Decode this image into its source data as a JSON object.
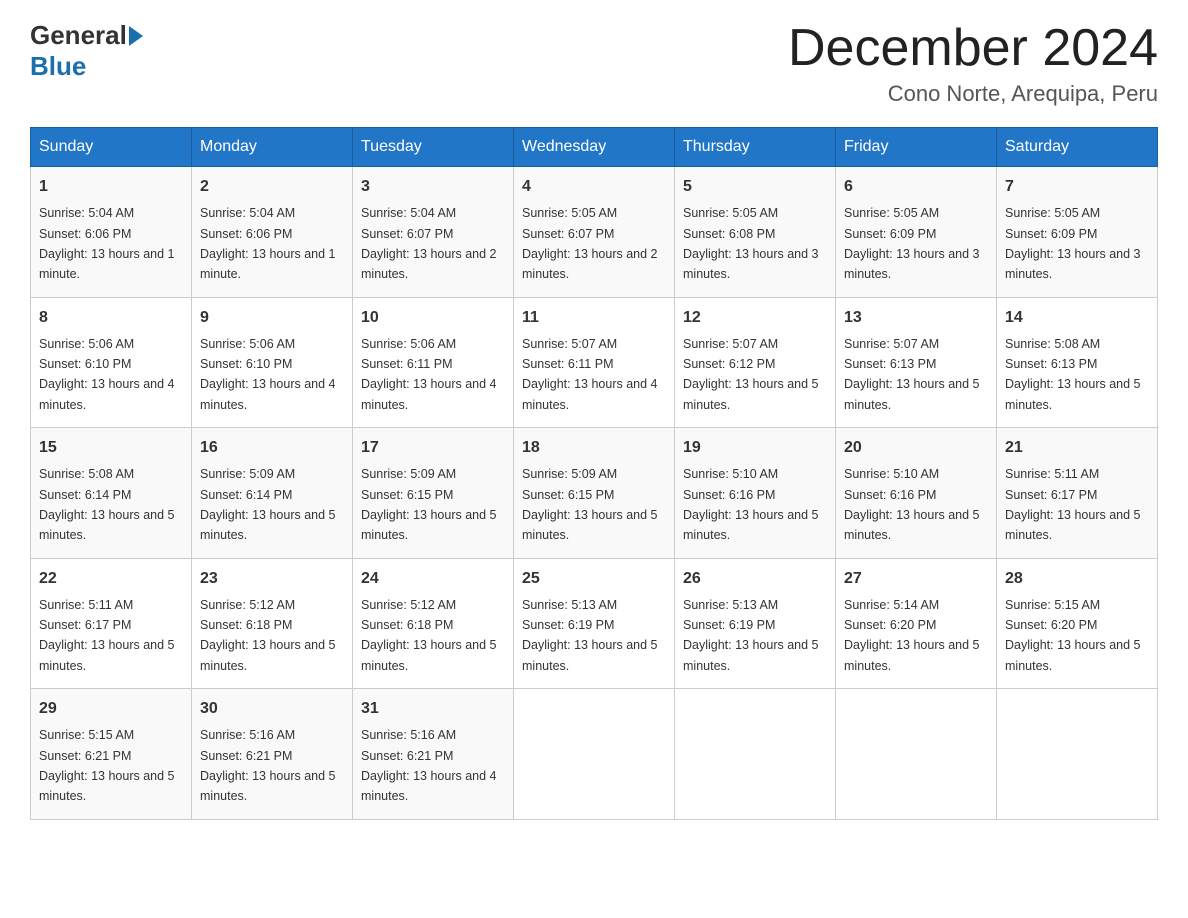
{
  "logo": {
    "general": "General",
    "blue": "Blue"
  },
  "title": {
    "month_year": "December 2024",
    "location": "Cono Norte, Arequipa, Peru"
  },
  "days_of_week": [
    "Sunday",
    "Monday",
    "Tuesday",
    "Wednesday",
    "Thursday",
    "Friday",
    "Saturday"
  ],
  "weeks": [
    [
      {
        "day": "1",
        "sunrise": "5:04 AM",
        "sunset": "6:06 PM",
        "daylight": "13 hours and 1 minute."
      },
      {
        "day": "2",
        "sunrise": "5:04 AM",
        "sunset": "6:06 PM",
        "daylight": "13 hours and 1 minute."
      },
      {
        "day": "3",
        "sunrise": "5:04 AM",
        "sunset": "6:07 PM",
        "daylight": "13 hours and 2 minutes."
      },
      {
        "day": "4",
        "sunrise": "5:05 AM",
        "sunset": "6:07 PM",
        "daylight": "13 hours and 2 minutes."
      },
      {
        "day": "5",
        "sunrise": "5:05 AM",
        "sunset": "6:08 PM",
        "daylight": "13 hours and 3 minutes."
      },
      {
        "day": "6",
        "sunrise": "5:05 AM",
        "sunset": "6:09 PM",
        "daylight": "13 hours and 3 minutes."
      },
      {
        "day": "7",
        "sunrise": "5:05 AM",
        "sunset": "6:09 PM",
        "daylight": "13 hours and 3 minutes."
      }
    ],
    [
      {
        "day": "8",
        "sunrise": "5:06 AM",
        "sunset": "6:10 PM",
        "daylight": "13 hours and 4 minutes."
      },
      {
        "day": "9",
        "sunrise": "5:06 AM",
        "sunset": "6:10 PM",
        "daylight": "13 hours and 4 minutes."
      },
      {
        "day": "10",
        "sunrise": "5:06 AM",
        "sunset": "6:11 PM",
        "daylight": "13 hours and 4 minutes."
      },
      {
        "day": "11",
        "sunrise": "5:07 AM",
        "sunset": "6:11 PM",
        "daylight": "13 hours and 4 minutes."
      },
      {
        "day": "12",
        "sunrise": "5:07 AM",
        "sunset": "6:12 PM",
        "daylight": "13 hours and 5 minutes."
      },
      {
        "day": "13",
        "sunrise": "5:07 AM",
        "sunset": "6:13 PM",
        "daylight": "13 hours and 5 minutes."
      },
      {
        "day": "14",
        "sunrise": "5:08 AM",
        "sunset": "6:13 PM",
        "daylight": "13 hours and 5 minutes."
      }
    ],
    [
      {
        "day": "15",
        "sunrise": "5:08 AM",
        "sunset": "6:14 PM",
        "daylight": "13 hours and 5 minutes."
      },
      {
        "day": "16",
        "sunrise": "5:09 AM",
        "sunset": "6:14 PM",
        "daylight": "13 hours and 5 minutes."
      },
      {
        "day": "17",
        "sunrise": "5:09 AM",
        "sunset": "6:15 PM",
        "daylight": "13 hours and 5 minutes."
      },
      {
        "day": "18",
        "sunrise": "5:09 AM",
        "sunset": "6:15 PM",
        "daylight": "13 hours and 5 minutes."
      },
      {
        "day": "19",
        "sunrise": "5:10 AM",
        "sunset": "6:16 PM",
        "daylight": "13 hours and 5 minutes."
      },
      {
        "day": "20",
        "sunrise": "5:10 AM",
        "sunset": "6:16 PM",
        "daylight": "13 hours and 5 minutes."
      },
      {
        "day": "21",
        "sunrise": "5:11 AM",
        "sunset": "6:17 PM",
        "daylight": "13 hours and 5 minutes."
      }
    ],
    [
      {
        "day": "22",
        "sunrise": "5:11 AM",
        "sunset": "6:17 PM",
        "daylight": "13 hours and 5 minutes."
      },
      {
        "day": "23",
        "sunrise": "5:12 AM",
        "sunset": "6:18 PM",
        "daylight": "13 hours and 5 minutes."
      },
      {
        "day": "24",
        "sunrise": "5:12 AM",
        "sunset": "6:18 PM",
        "daylight": "13 hours and 5 minutes."
      },
      {
        "day": "25",
        "sunrise": "5:13 AM",
        "sunset": "6:19 PM",
        "daylight": "13 hours and 5 minutes."
      },
      {
        "day": "26",
        "sunrise": "5:13 AM",
        "sunset": "6:19 PM",
        "daylight": "13 hours and 5 minutes."
      },
      {
        "day": "27",
        "sunrise": "5:14 AM",
        "sunset": "6:20 PM",
        "daylight": "13 hours and 5 minutes."
      },
      {
        "day": "28",
        "sunrise": "5:15 AM",
        "sunset": "6:20 PM",
        "daylight": "13 hours and 5 minutes."
      }
    ],
    [
      {
        "day": "29",
        "sunrise": "5:15 AM",
        "sunset": "6:21 PM",
        "daylight": "13 hours and 5 minutes."
      },
      {
        "day": "30",
        "sunrise": "5:16 AM",
        "sunset": "6:21 PM",
        "daylight": "13 hours and 5 minutes."
      },
      {
        "day": "31",
        "sunrise": "5:16 AM",
        "sunset": "6:21 PM",
        "daylight": "13 hours and 4 minutes."
      },
      null,
      null,
      null,
      null
    ]
  ],
  "labels": {
    "sunrise": "Sunrise:",
    "sunset": "Sunset:",
    "daylight": "Daylight:"
  }
}
